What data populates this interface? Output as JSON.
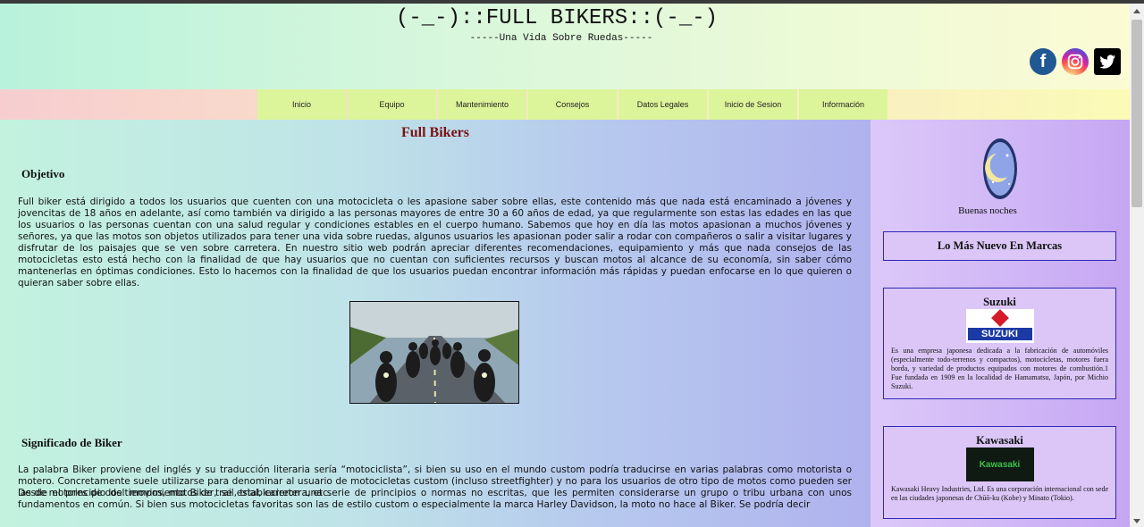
{
  "header": {
    "title": "(-_-)::FULL BIKERS::(-_-)",
    "subtitle": "-----Una Vida Sobre Ruedas-----",
    "socials": [
      {
        "name": "facebook",
        "icon": "facebook-icon",
        "glyph": "f"
      },
      {
        "name": "instagram",
        "icon": "instagram-icon"
      },
      {
        "name": "twitter",
        "icon": "twitter-icon"
      }
    ]
  },
  "nav": {
    "items": [
      "Inicio",
      "Equipo",
      "Mantenimiento",
      "Consejos",
      "Datos Legales",
      "Inicio de Sesion",
      "Información"
    ]
  },
  "main": {
    "title": "Full Bikers",
    "sections": [
      {
        "heading": "Objetivo",
        "text": "Full biker está dirigido a todos los usuarios que cuenten con una motocicleta o les apasione saber sobre ellas, este contenido más que nada está encaminado a jóvenes y jovencitas de 18 años en adelante, así como también va dirigido a las personas mayores de entre 30 a 60 años de edad, ya que regularmente son estas las edades en las que los usuarios o las personas cuentan con una salud regular y condiciones estables en el cuerpo humano. Sabemos que hoy en día las motos apasionan a muchos jóvenes y señores, ya que las motos son objetos utilizados para tener una vida sobre ruedas, algunos usuarios les apasionan poder salir a rodar con compañeros o salir a visitar lugares y disfrutar de los paisajes que se ven sobre carretera. En nuestro sitio web podrán apreciar diferentes recomendaciones, equipamiento y más que nada consejos de las motocicletas esto está hecho con la finalidad de que hay usuarios que no cuentan con suficientes recursos y buscan motos al alcance de su economía, sin saber cómo mantenerlas en óptimas condiciones. Esto lo hacemos con la finalidad de que los usuarios puedan encontrar información más rápidas y puedan enfocarse en lo que quieren o quieran saber sobre ellas."
      },
      {
        "heading": "Significado de Biker",
        "text": "La palabra Biker proviene del inglés y su traducción literaria sería “motociclista”, si bien su uso en el mundo custom podría traducirse en varias palabras como motorista o motero. Concretamente suele utilizarse para denominar al usuario de motocicletas custom (incluso streetfighter) y no para los usuarios de otro tipo de motos como pueden ser las de motores de dos tiempos, motos de trail, trial, carretera, etc.",
        "text2": "Desde el principio del movimiento Biker, se establecieron una serie de principios o normas no escritas, que les permiten considerarse un grupo o tribu urbana con unos fundamentos en común. Si bien sus motocicletas favoritas son las de estilo custom o especialmente la marca Harley Davidson, la moto no hace al Biker. Se podría decir"
      }
    ]
  },
  "sidebar": {
    "greeting": "Buenas noches",
    "news_title": "Lo Más Nuevo En Marcas",
    "brands": [
      {
        "name": "Suzuki",
        "logo_text": "SUZUKI",
        "desc": "Es una empresa japonesa dedicada a la fabricación de automóviles (especialmente todo-terrenos y compactos), motocicletas, motores fuera borda, y variedad de productos equipados con motores de combustión.1 Fue fundada en 1909 en la localidad de Hamamatsu, Japón, por Michio Suzuki."
      },
      {
        "name": "Kawasaki",
        "logo_text": "Kawasaki",
        "desc": "Kawasaki Heavy Industries, Ltd. Es una corporación internacional con sede en las ciudades japonesas de Chūō-ku (Kobe) y Minato (Tokio)."
      }
    ]
  },
  "colors": {
    "title_red": "#7a1212",
    "nav_item": "#ddf59a",
    "box_border": "#2e27b8"
  }
}
